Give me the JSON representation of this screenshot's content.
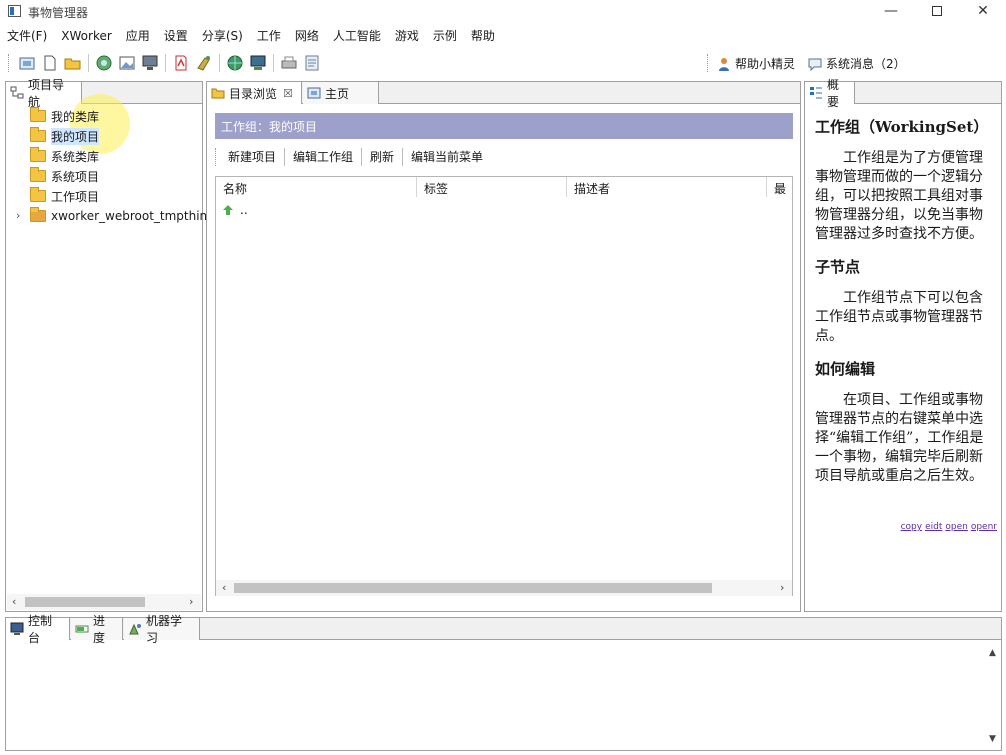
{
  "window": {
    "title": "事物管理器",
    "minimize": "—",
    "close": "✕"
  },
  "menu": [
    "文件(F)",
    "XWorker",
    "应用",
    "设置",
    "分享(S)",
    "工作",
    "网络",
    "人工智能",
    "游戏",
    "示例",
    "帮助"
  ],
  "toolbar": {
    "helper_label": "帮助小精灵",
    "messages_label": "系统消息（2）",
    "icons": [
      "home-icon",
      "new-file-icon",
      "open-folder-icon",
      "refresh-globe-icon",
      "image-icon",
      "monitor-icon",
      "pdf-icon",
      "cleaner-icon",
      "globe-icon",
      "desktop-icon",
      "printer-icon",
      "document-icon"
    ]
  },
  "nav": {
    "tab_label": "项目导航",
    "items": [
      {
        "label": "我的类库"
      },
      {
        "label": "我的项目",
        "selected": true
      },
      {
        "label": "系统类库"
      },
      {
        "label": "系统项目"
      },
      {
        "label": "工作项目"
      },
      {
        "label": "xworker_webroot_tmpthin"
      }
    ]
  },
  "browse": {
    "tab_label": "目录浏览",
    "tab_close": "☒",
    "home_tab_label": "主页",
    "group_title": "工作组：我的项目",
    "actions": [
      "新建项目",
      "编辑工作组",
      "刷新",
      "编辑当前菜单"
    ],
    "columns": [
      "名称",
      "标签",
      "描述者",
      "最后"
    ],
    "up_row": ".."
  },
  "summary": {
    "tab_label": "概要",
    "sections": [
      {
        "heading": "工作组（WorkingSet）",
        "text": "工作组是为了方便管理事物管理而做的一个逻辑分组，可以把按照工具组对事物管理器分组，以免当事物管理器过多时查找不方便。"
      },
      {
        "heading": "子节点",
        "text": "工作组节点下可以包含工作组节点或事物管理器节点。"
      },
      {
        "heading": "如何编辑",
        "text": "在项目、工作组或事物管理器节点的右键菜单中选择“编辑工作组”，工作组是一个事物，编辑完毕后刷新项目导航或重启之后生效。"
      }
    ],
    "links": [
      "copy",
      "eidt",
      "open",
      "openr"
    ]
  },
  "console": {
    "tabs": [
      "控制台",
      "进度",
      "机器学习"
    ]
  },
  "colors": {
    "group_bar": "#9ea0cc",
    "selection": "#cfe6ff",
    "link": "#5b2fae"
  }
}
